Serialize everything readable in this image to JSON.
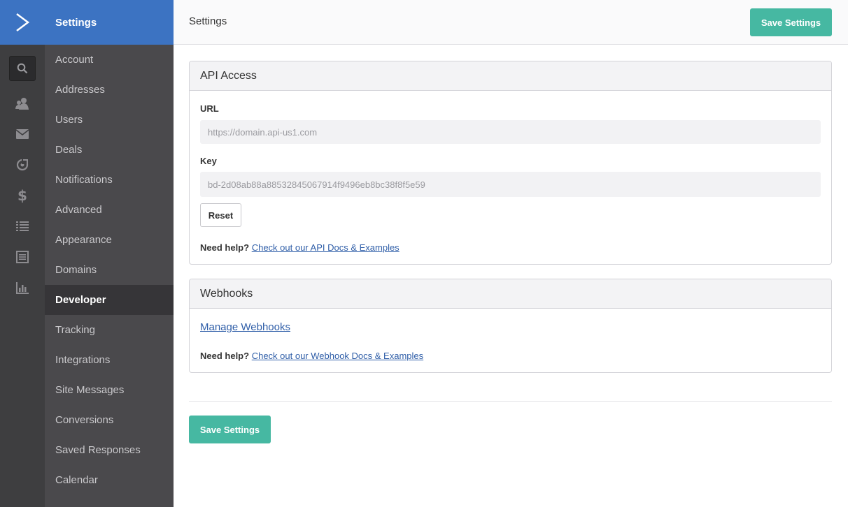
{
  "rail": {
    "logo_icon": "chevron-right-logo-icon",
    "icons": [
      "search-icon",
      "contacts-icon",
      "mail-icon",
      "automations-icon",
      "deals-icon",
      "lists-icon",
      "forms-icon",
      "reports-icon"
    ]
  },
  "nav": {
    "title": "Settings",
    "items": [
      {
        "label": "Account"
      },
      {
        "label": "Addresses"
      },
      {
        "label": "Users"
      },
      {
        "label": "Deals"
      },
      {
        "label": "Notifications"
      },
      {
        "label": "Advanced"
      },
      {
        "label": "Appearance"
      },
      {
        "label": "Domains"
      },
      {
        "label": "Developer",
        "active": true
      },
      {
        "label": "Tracking"
      },
      {
        "label": "Integrations"
      },
      {
        "label": "Site Messages"
      },
      {
        "label": "Conversions"
      },
      {
        "label": "Saved Responses"
      },
      {
        "label": "Calendar"
      }
    ]
  },
  "header": {
    "title": "Settings",
    "save_label": "Save Settings"
  },
  "api_access": {
    "title": "API Access",
    "url_label": "URL",
    "url_value": "https://domain.api-us1.com",
    "key_label": "Key",
    "key_value": "bd-2d08ab88a88532845067914f9496eb8bc38f8f5e59",
    "reset_label": "Reset",
    "help_prefix": "Need help?",
    "help_link": "Check out our API Docs & Examples"
  },
  "webhooks": {
    "title": "Webhooks",
    "manage_link": "Manage Webhooks",
    "help_prefix": "Need help?",
    "help_link": "Check out our Webhook Docs & Examples"
  },
  "footer": {
    "save_label": "Save Settings"
  },
  "colors": {
    "brand_blue": "#3c73c2",
    "save_green": "#46b8a2",
    "link_blue": "#2f5ea8"
  }
}
